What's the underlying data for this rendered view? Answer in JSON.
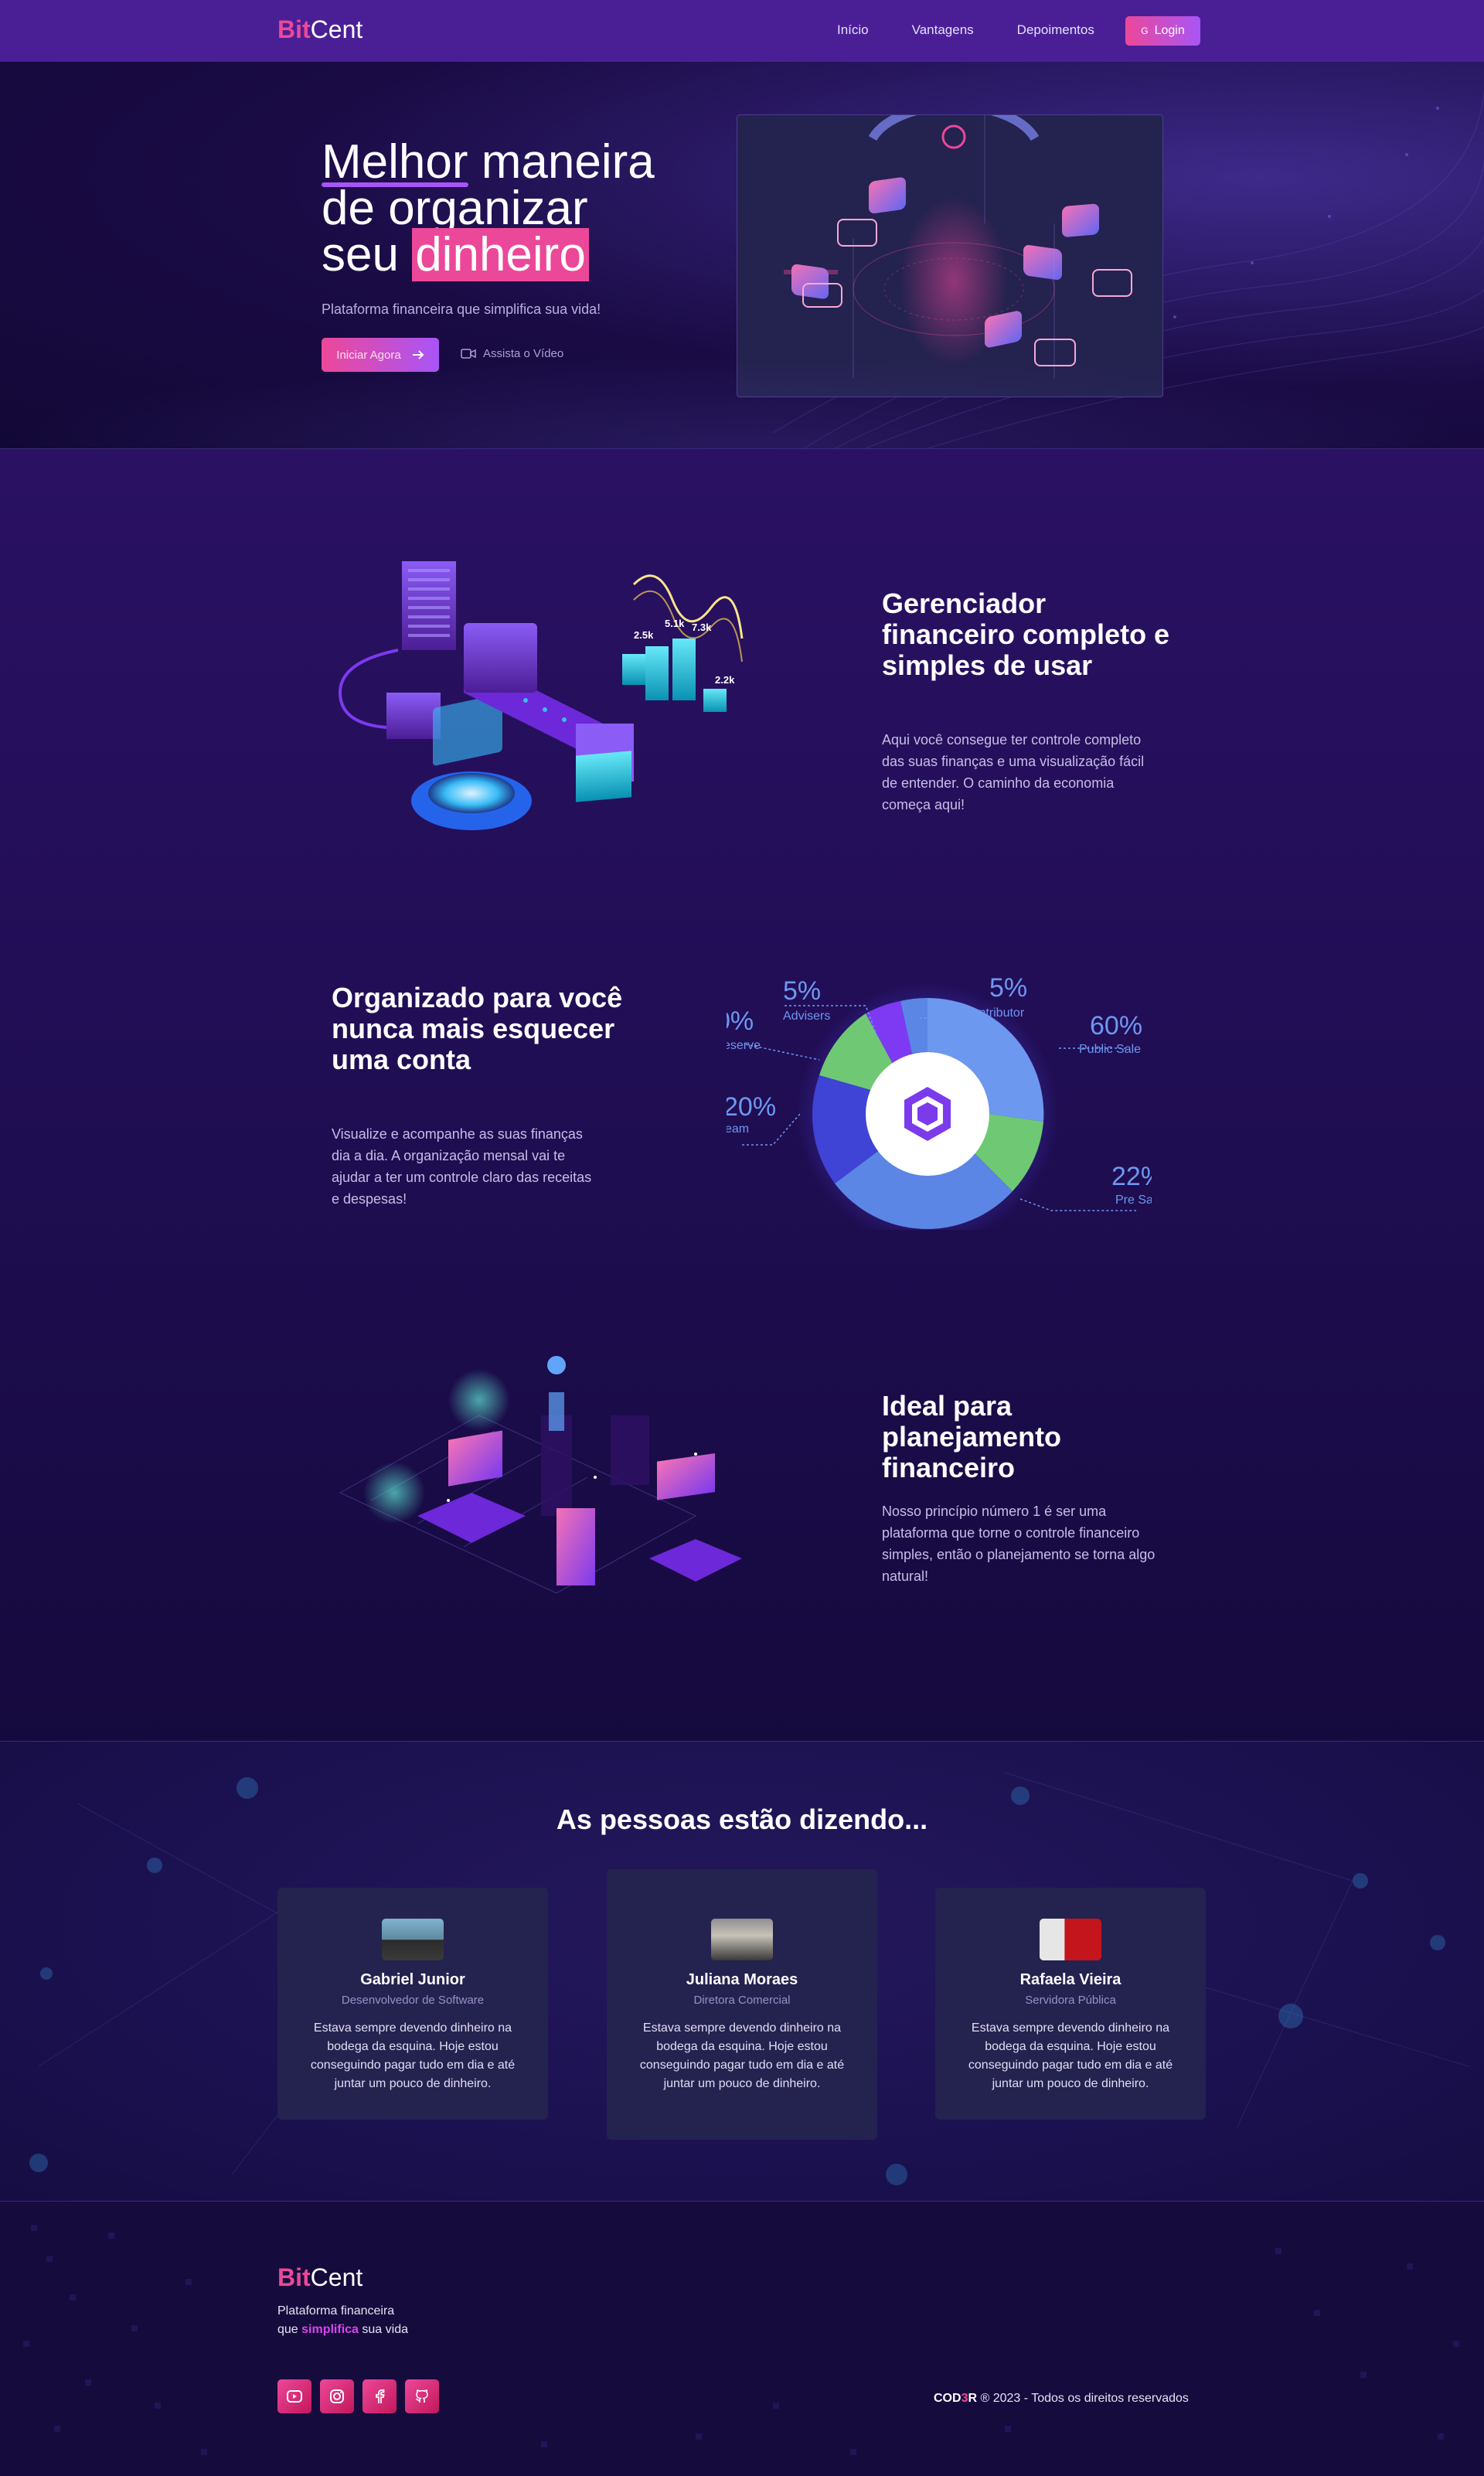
{
  "brand": {
    "bit": "Bit",
    "cent": "Cent"
  },
  "nav": {
    "links": [
      "Início",
      "Vantagens",
      "Depoimentos"
    ],
    "login_label": "Login",
    "login_icon": "google-icon"
  },
  "hero": {
    "title_line1_a": "Melhor",
    "title_line1_b": " maneira",
    "title_line2": "de organizar",
    "title_line3_a": "seu ",
    "title_line3_b": "dinheiro",
    "subtitle": "Plataforma financeira que simplifica sua vida!",
    "start_label": "Iniciar Agora",
    "video_label": "Assista o Vídeo"
  },
  "features": [
    {
      "title": "Gerenciador financeiro completo e simples de usar",
      "text": "Aqui você consegue ter controle completo das suas finanças e uma visualização fácil de entender. O caminho da economia começa aqui!"
    },
    {
      "title": "Organizado para você nunca mais esquecer uma conta",
      "text": "Visualize e acompanhe as suas finanças dia a dia. A organização mensal vai te ajudar a ter um controle claro das receitas e despesas!"
    },
    {
      "title": "Ideal para planejamento financeiro",
      "text": "Nosso princípio número 1 é ser uma plataforma que torne o controle financeiro simples, então o planejamento se torna algo natural!"
    }
  ],
  "feature1_chart_labels": [
    "2.5k",
    "5.1k",
    "7.3k",
    "2.2k"
  ],
  "donut": {
    "labels": [
      {
        "pct": "5%",
        "name": "Advisers"
      },
      {
        "pct": "5%",
        "name": "Contributor"
      },
      {
        "pct": "60%",
        "name": "Public Sale"
      },
      {
        "pct": "22%",
        "name": "Pre Sa"
      },
      {
        "pct": "20%",
        "name": "eam"
      },
      {
        "pct": "0%",
        "name": "eserve"
      }
    ]
  },
  "testimonials": {
    "title": "As pessoas estão dizendo...",
    "items": [
      {
        "name": "Gabriel Junior",
        "role": "Desenvolvedor de Software",
        "quote": "Estava sempre devendo dinheiro na bodega da esquina. Hoje estou conseguindo pagar tudo em dia e até juntar um pouco de dinheiro."
      },
      {
        "name": "Juliana Moraes",
        "role": "Diretora Comercial",
        "quote": "Estava sempre devendo dinheiro na bodega da esquina. Hoje estou conseguindo pagar tudo em dia e até juntar um pouco de dinheiro."
      },
      {
        "name": "Rafaela Vieira",
        "role": "Servidora Pública",
        "quote": "Estava sempre devendo dinheiro na bodega da esquina. Hoje estou conseguindo pagar tudo em dia e até juntar um pouco de dinheiro."
      }
    ]
  },
  "footer": {
    "tag_line1": "Plataforma financeira",
    "tag_pre": "que ",
    "tag_hi": "simplifica",
    "tag_post": " sua vida",
    "socials": [
      "youtube-icon",
      "instagram-icon",
      "facebook-icon",
      "github-icon"
    ],
    "copy_brand_a": "COD",
    "copy_brand_b": "3",
    "copy_brand_c": "R",
    "copy_rest": " ® 2023 - Todos os direitos reservados"
  },
  "colors": {
    "accent": "#ec4899",
    "purple": "#a855f7",
    "nav_bg": "#4a1f96"
  }
}
